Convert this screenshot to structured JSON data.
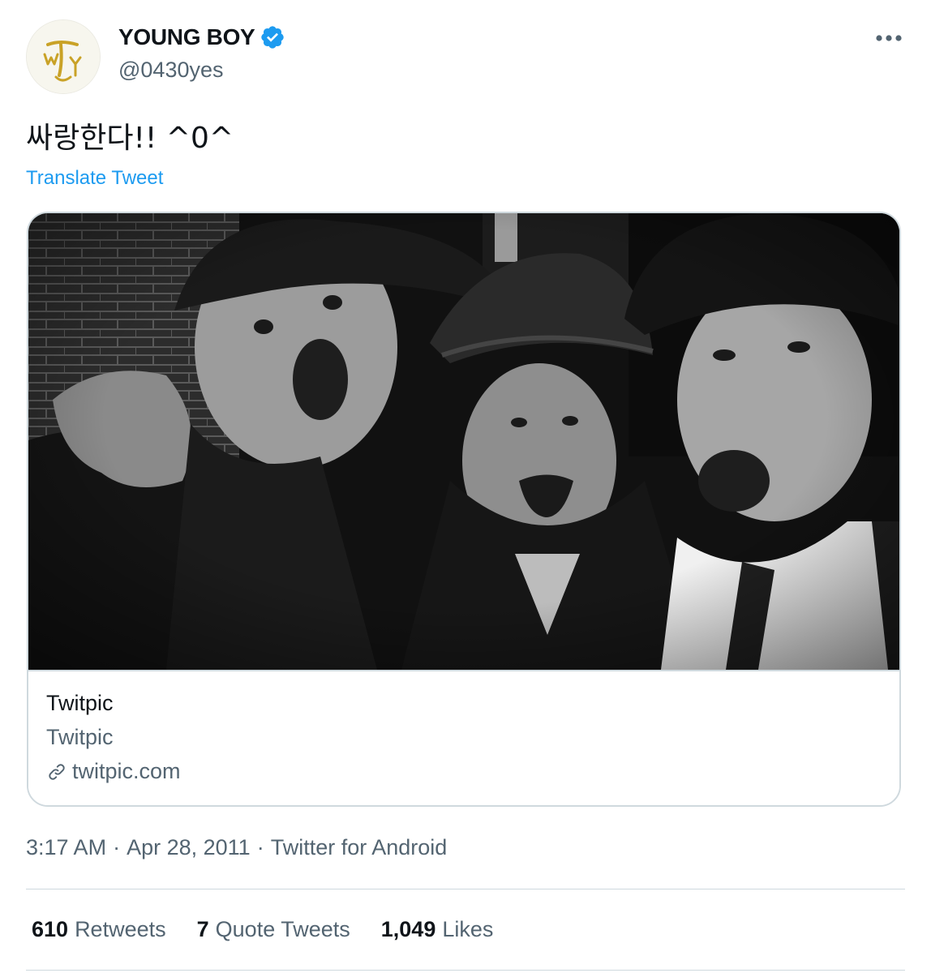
{
  "author": {
    "display_name": "YOUNG BOY",
    "handle": "@0430yes",
    "verified": true,
    "avatar_icon": "calligraphy-logo-avatar"
  },
  "menu": {
    "icon": "more-horizontal-icon"
  },
  "tweet": {
    "text": "싸랑한다!! ^0^",
    "translate_label": "Translate Tweet"
  },
  "card": {
    "image_alt": "black-and-white photo of three young men in caps making surprised faces",
    "site": "Twitpic",
    "title": "Twitpic",
    "domain": "twitpic.com",
    "link_icon": "link-icon"
  },
  "meta": {
    "time": "3:17 AM",
    "separator": "·",
    "date": "Apr 28, 2011",
    "source": "Twitter for Android"
  },
  "stats": [
    {
      "count": "610",
      "label": "Retweets"
    },
    {
      "count": "7",
      "label": "Quote Tweets"
    },
    {
      "count": "1,049",
      "label": "Likes"
    }
  ],
  "colors": {
    "accent": "#1d9bf0",
    "text_primary": "#0f1419",
    "text_secondary": "#536471",
    "border": "#cfd9de",
    "avatar_gold": "#c9a227"
  }
}
